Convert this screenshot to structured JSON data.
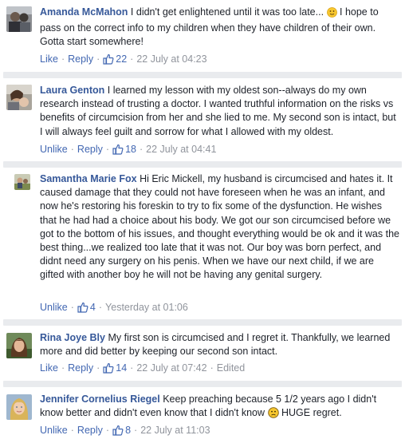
{
  "comments": [
    {
      "author": "Amanda McMahon",
      "text_before": "I didn't get enlightened until it was too late... ",
      "emoji": "slightly-smiling-emoji",
      "text_after": " I hope to pass on the correct info to my children when they have children of their own. Gotta start somewhere!",
      "action": "Like",
      "reply": "Reply",
      "likes": "22",
      "time": "22 July at 04:23",
      "edited": ""
    },
    {
      "author": "Laura Genton",
      "text": "I learned my lesson with my oldest son--always do my own research instead of trusting a doctor. I wanted truthful information on the risks vs benefits of circumcision from her and she lied to me. My second son is intact, but I will always feel guilt and sorrow for what I allowed with my oldest.",
      "action": "Unlike",
      "reply": "Reply",
      "likes": "18",
      "time": "22 July at 04:41",
      "edited": ""
    },
    {
      "author": "Samantha Marie Fox",
      "text": "Hi Eric Mickell, my husband is circumcised and hates it. It caused damage that they could not have foreseen when he was an infant, and now he's restoring his foreskin to try to fix some of the dysfunction. He wishes that he had had a choice about his body. We got our son circumcised before we got to the bottom of his issues, and thought everything would be ok and it was the best thing...we realized too late that it was not. Our boy was born perfect, and didnt need any surgery on his penis. When we have our next child, if we are gifted with another boy he will not be having any genital surgery.",
      "action": "Unlike",
      "likes": "4",
      "time": "Yesterday at 01:06",
      "edited": ""
    },
    {
      "author": "Rina Joye Bly",
      "text": "My first son is circumcised and I regret it. Thankfully, we learned more and did better by keeping our second son intact.",
      "action": "Like",
      "reply": "Reply",
      "likes": "14",
      "time": "22 July at 07:42",
      "edited": "Edited"
    },
    {
      "author": "Jennifer Cornelius Riegel",
      "text_before": "Keep preaching because 5 1/2 years ago I didn't know better and didn't even know that I didn't know ",
      "emoji": "frowning-emoji",
      "text_after": " HUGE regret.",
      "action": "Unlike",
      "reply": "Reply",
      "likes": "8",
      "time": "22 July at 11:03",
      "edited": ""
    }
  ],
  "colors": {
    "link": "#4267b2",
    "author": "#365899",
    "meta": "#90949c",
    "separator": "#e9ebee"
  }
}
